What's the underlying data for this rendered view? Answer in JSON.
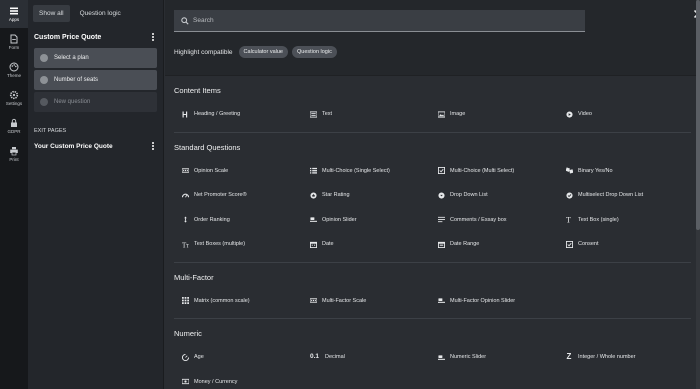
{
  "rail": [
    {
      "label": "Apps",
      "icon": "apps-icon",
      "active": true
    },
    {
      "label": "Form",
      "icon": "form-icon"
    },
    {
      "label": "Theme",
      "icon": "theme-icon"
    },
    {
      "label": "Settings",
      "icon": "settings-icon"
    },
    {
      "label": "GDPR",
      "icon": "gdpr-icon"
    },
    {
      "label": "Print",
      "icon": "print-icon"
    }
  ],
  "panel": {
    "tabs": [
      "Show all",
      "Question logic"
    ],
    "title": "Custom Price Quote",
    "pages": [
      "Select a plan",
      "Number of seats",
      "New question"
    ],
    "exit_label": "EXIT PAGES",
    "exit_title": "Your Custom Price Quote"
  },
  "search": {
    "placeholder": "Search"
  },
  "highlight": {
    "label": "Highlight compatible",
    "chips": [
      "Calculator value",
      "Question logic"
    ]
  },
  "sections": [
    {
      "title": "Content Items",
      "items": [
        {
          "label": "Heading / Greeting",
          "icon": "heading-icon"
        },
        {
          "label": "Text",
          "icon": "text-icon"
        },
        {
          "label": "Image",
          "icon": "image-icon"
        },
        {
          "label": "Video",
          "icon": "video-icon"
        }
      ]
    },
    {
      "title": "Standard Questions",
      "items": [
        {
          "label": "Opinion Scale",
          "icon": "opinion-scale-icon"
        },
        {
          "label": "Multi-Choice (Single Select)",
          "icon": "list-icon"
        },
        {
          "label": "Multi-Choice (Multi Select)",
          "icon": "checkbox-icon"
        },
        {
          "label": "Binary Yes/No",
          "icon": "binary-icon"
        },
        {
          "label": "Net Promoter Score®",
          "icon": "gauge-icon"
        },
        {
          "label": "Star Rating",
          "icon": "star-icon"
        },
        {
          "label": "Drop Down List",
          "icon": "dropdown-icon"
        },
        {
          "label": "Multiselect Drop Down List",
          "icon": "multiselect-icon"
        },
        {
          "label": "Order Ranking",
          "icon": "ranking-icon"
        },
        {
          "label": "Opinion Slider",
          "icon": "slider-icon"
        },
        {
          "label": "Comments / Essay box",
          "icon": "comments-icon"
        },
        {
          "label": "Text Box (single)",
          "icon": "textbox-icon"
        },
        {
          "label": "Text Boxes (multiple)",
          "icon": "textboxes-icon"
        },
        {
          "label": "Date",
          "icon": "calendar-icon"
        },
        {
          "label": "Date Range",
          "icon": "calendar-range-icon"
        },
        {
          "label": "Consent",
          "icon": "consent-icon"
        }
      ]
    },
    {
      "title": "Multi-Factor",
      "items": [
        {
          "label": "Matrix (common scale)",
          "icon": "matrix-icon"
        },
        {
          "label": "Multi-Factor Scale",
          "icon": "scale-icon"
        },
        {
          "label": "Multi-Factor Opinion Slider",
          "icon": "slider-icon"
        }
      ]
    },
    {
      "title": "Numeric",
      "items": [
        {
          "label": "Age",
          "icon": "age-icon"
        },
        {
          "label": "Decimal",
          "icon": "decimal-icon",
          "glyph": "0.1"
        },
        {
          "label": "Numeric Slider",
          "icon": "slider-icon"
        },
        {
          "label": "Integer / Whole number",
          "icon": "integer-icon",
          "glyph": "Z"
        },
        {
          "label": "Money / Currency",
          "icon": "money-icon"
        }
      ]
    }
  ]
}
